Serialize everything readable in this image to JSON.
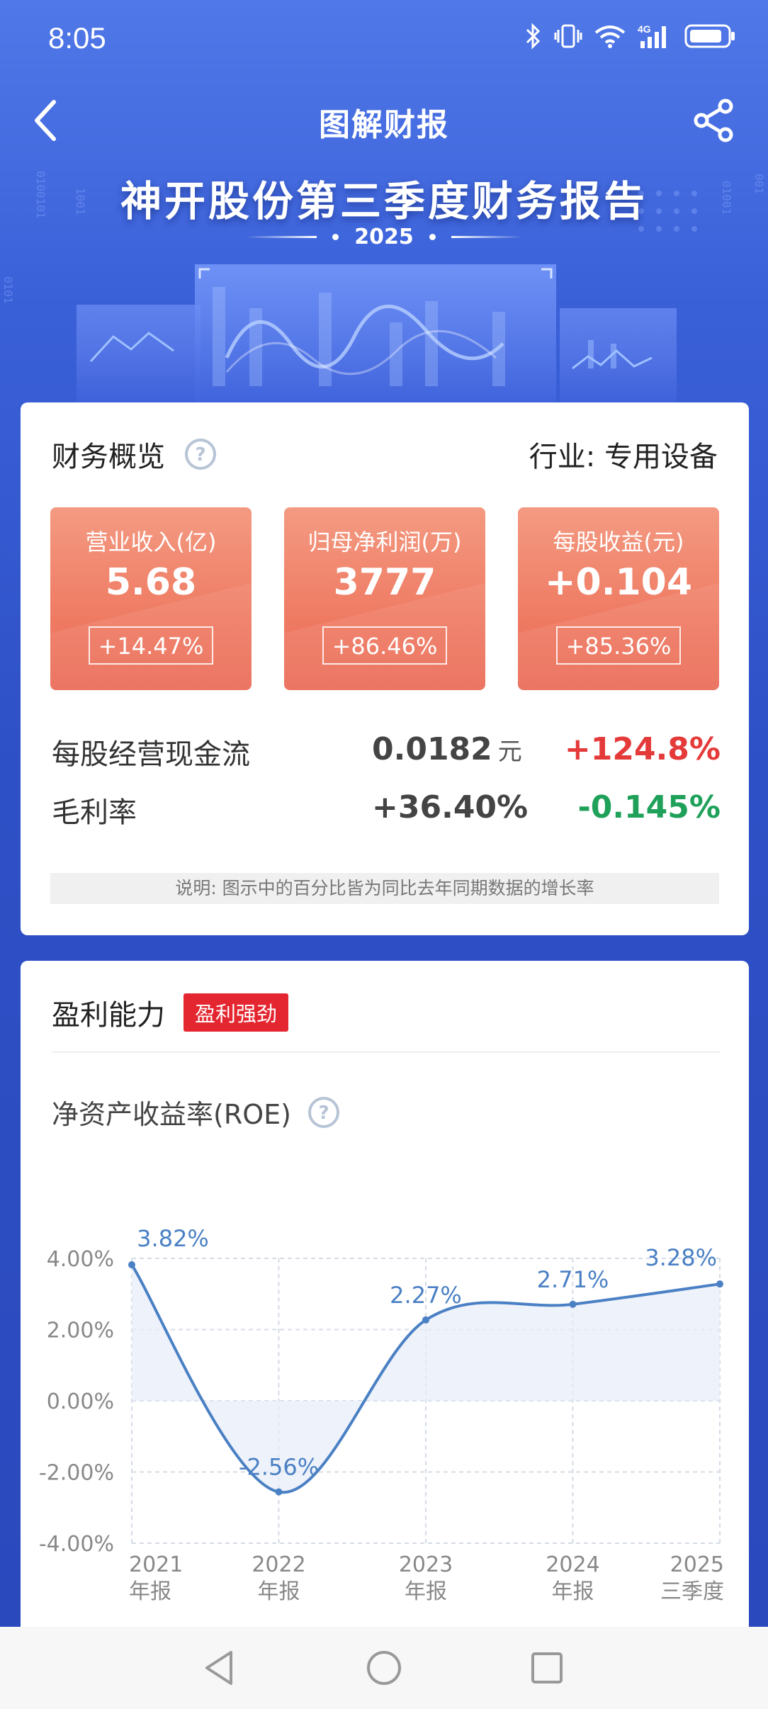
{
  "status_bar": {
    "time": "8:05"
  },
  "header": {
    "title": "图解财报"
  },
  "hero": {
    "title": "神开股份第三季度财务报告",
    "year": "2025"
  },
  "overview": {
    "title": "财务概览",
    "industry": "行业: 专用设备",
    "tiles": [
      {
        "label": "营业收入(亿)",
        "value": "5.68",
        "change": "+14.47%"
      },
      {
        "label": "归母净利润(万)",
        "value": "3777",
        "change": "+86.46%"
      },
      {
        "label": "每股收益(元)",
        "value": "+0.104",
        "change": "+85.36%"
      }
    ],
    "stats": [
      {
        "label": "每股经营现金流",
        "value": "0.0182",
        "unit": "元",
        "change": "+124.8%",
        "direction": "up"
      },
      {
        "label": "毛利率",
        "value": "+36.40%",
        "unit": "",
        "change": "-0.145%",
        "direction": "down"
      }
    ],
    "note": "说明: 图示中的百分比皆为同比去年同期数据的增长率"
  },
  "profitability": {
    "title": "盈利能力",
    "badge": "盈利强劲",
    "chart_title": "净资产收益率(ROE)"
  },
  "colors": {
    "accent_blue": "#3a60d8",
    "tile_orange": "#ef7b63",
    "up_red": "#e53a3a",
    "down_green": "#1fa15a",
    "line_blue": "#4a80c4",
    "badge_red": "#e3262f"
  },
  "icons": [
    "back-arrow-icon",
    "share-icon",
    "help-icon",
    "bluetooth-icon",
    "vibrate-icon",
    "wifi-icon",
    "signal-4g-icon",
    "battery-icon"
  ],
  "chart_data": {
    "type": "line",
    "title": "净资产收益率(ROE)",
    "x": [
      "2021 年报",
      "2022 年报",
      "2023 年报",
      "2024 年报",
      "2025 三季度"
    ],
    "x_tick_lines": [
      [
        "2021",
        "年报"
      ],
      [
        "2022",
        "年报"
      ],
      [
        "2023",
        "年报"
      ],
      [
        "2024",
        "年报"
      ],
      [
        "2025",
        "三季度"
      ]
    ],
    "values": [
      3.82,
      -2.56,
      2.27,
      2.71,
      3.28
    ],
    "data_labels": [
      "3.82%",
      "-2.56%",
      "2.27%",
      "2.71%",
      "3.28%"
    ],
    "y_ticks": [
      "4.00%",
      "2.00%",
      "0.00%",
      "-2.00%",
      "-4.00%"
    ],
    "ylim": [
      -4,
      4
    ],
    "grid": true,
    "fill": "area-to-zero"
  }
}
